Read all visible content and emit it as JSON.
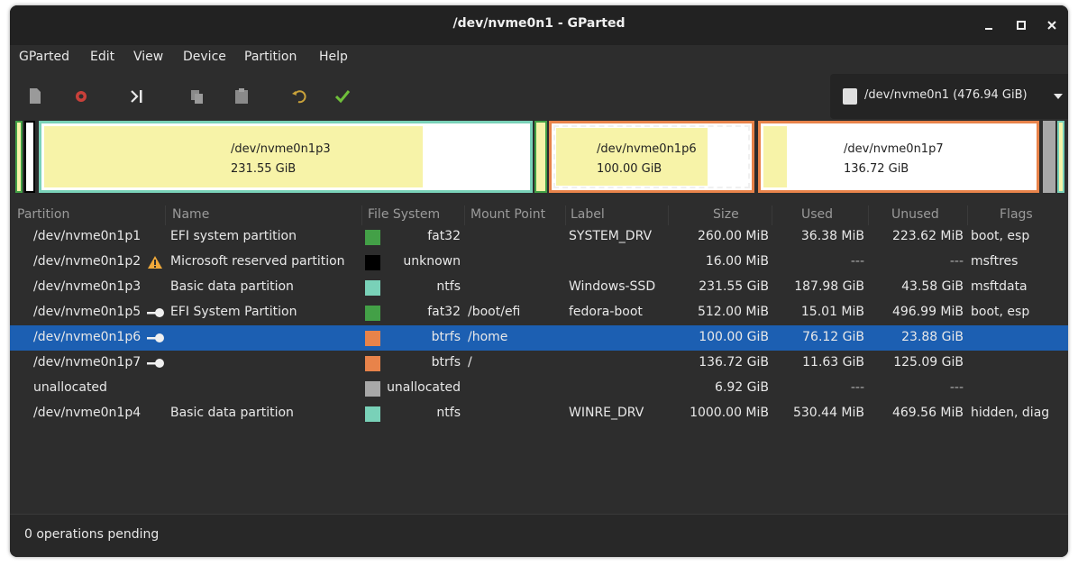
{
  "window": {
    "title": "/dev/nvme0n1 - GParted"
  },
  "menu": [
    "GParted",
    "Edit",
    "View",
    "Device",
    "Partition",
    "Help"
  ],
  "toolbar": {
    "icons": [
      "new-icon",
      "delete-icon",
      "resize-move-icon",
      "copy-icon",
      "paste-icon",
      "undo-icon",
      "apply-icon"
    ]
  },
  "device": {
    "label": "/dev/nvme0n1 (476.94 GiB)"
  },
  "disk_map": [
    {
      "name": "/dev/nvme0n1p3",
      "size": "231.55 GiB"
    },
    {
      "name": "/dev/nvme0n1p6",
      "size": "100.00 GiB"
    },
    {
      "name": "/dev/nvme0n1p7",
      "size": "136.72 GiB"
    }
  ],
  "table": {
    "headers": [
      "Partition",
      "Name",
      "File System",
      "Mount Point",
      "Label",
      "Size",
      "Used",
      "Unused",
      "Flags"
    ],
    "rows": [
      {
        "partition": "/dev/nvme0n1p1",
        "name": "EFI system partition",
        "fs": "fat32",
        "mount": "",
        "label": "SYSTEM_DRV",
        "size": "260.00 MiB",
        "used": "36.38 MiB",
        "unused": "223.62 MiB",
        "flags": "boot, esp",
        "color": "#43a047",
        "icon": ""
      },
      {
        "partition": "/dev/nvme0n1p2",
        "name": "Microsoft reserved partition",
        "fs": "unknown",
        "mount": "",
        "label": "",
        "size": "16.00 MiB",
        "used": "---",
        "unused": "---",
        "flags": "msftres",
        "color": "#000000",
        "icon": "warning-icon"
      },
      {
        "partition": "/dev/nvme0n1p3",
        "name": "Basic data partition",
        "fs": "ntfs",
        "mount": "",
        "label": "Windows-SSD",
        "size": "231.55 GiB",
        "used": "187.98 GiB",
        "unused": "43.58 GiB",
        "flags": "msftdata",
        "color": "#79d1b8",
        "icon": ""
      },
      {
        "partition": "/dev/nvme0n1p5",
        "name": "EFI System Partition",
        "fs": "fat32",
        "mount": "/boot/efi",
        "label": "fedora-boot",
        "size": "512.00 MiB",
        "used": "15.01 MiB",
        "unused": "496.99 MiB",
        "flags": "boot, esp",
        "color": "#43a047",
        "icon": "key-icon"
      },
      {
        "partition": "/dev/nvme0n1p6",
        "name": "",
        "fs": "btrfs",
        "mount": "/home",
        "label": "",
        "size": "100.00 GiB",
        "used": "76.12 GiB",
        "unused": "23.88 GiB",
        "flags": "",
        "color": "#e8834a",
        "icon": "key-icon",
        "selected": true
      },
      {
        "partition": "/dev/nvme0n1p7",
        "name": "",
        "fs": "btrfs",
        "mount": "/",
        "label": "",
        "size": "136.72 GiB",
        "used": "11.63 GiB",
        "unused": "125.09 GiB",
        "flags": "",
        "color": "#e8834a",
        "icon": "key-icon"
      },
      {
        "partition": "unallocated",
        "name": "",
        "fs": "unallocated",
        "mount": "",
        "label": "",
        "size": "6.92 GiB",
        "used": "---",
        "unused": "---",
        "flags": "",
        "color": "#a8a8a8",
        "icon": ""
      },
      {
        "partition": "/dev/nvme0n1p4",
        "name": "Basic data partition",
        "fs": "ntfs",
        "mount": "",
        "label": "WINRE_DRV",
        "size": "1000.00 MiB",
        "used": "530.44 MiB",
        "unused": "469.56 MiB",
        "flags": "hidden, diag",
        "color": "#79d1b8",
        "icon": ""
      }
    ]
  },
  "status": {
    "text": "0 operations pending"
  },
  "colors": {
    "window_bg": "#2d2d2d",
    "selection": "#1c5fb2",
    "ntfs": "#79d1b8",
    "fat32": "#43a047",
    "btrfs": "#e8834a",
    "used_fill": "#f7f3a8"
  }
}
